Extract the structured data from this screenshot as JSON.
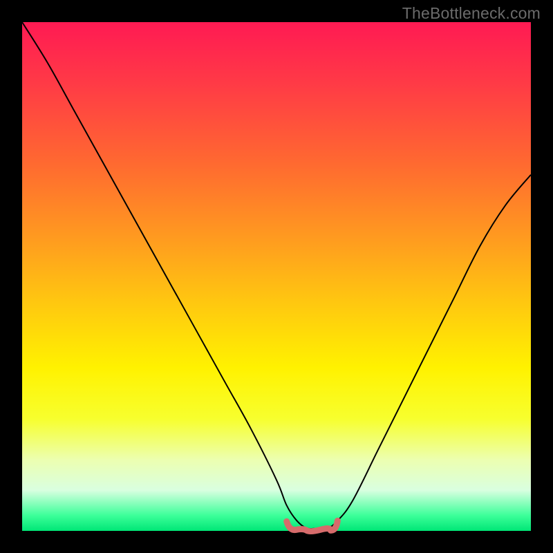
{
  "watermark": "TheBottleneck.com",
  "colors": {
    "frame": "#000000",
    "curve": "#000000",
    "trough_marker": "#d66b6b",
    "gradient_stops": [
      "#ff1a53",
      "#ff3a46",
      "#ff6a30",
      "#ff9920",
      "#ffc710",
      "#fff200",
      "#f7ff2e",
      "#ecffb0",
      "#d9ffe0",
      "#3bff99",
      "#00e676"
    ]
  },
  "chart_data": {
    "type": "line",
    "title": "",
    "xlabel": "",
    "ylabel": "",
    "annotations": [
      "TheBottleneck.com"
    ],
    "grid": false,
    "legend": false,
    "xlim": [
      0,
      100
    ],
    "ylim": [
      0,
      100
    ],
    "series": [
      {
        "name": "bottleneck-curve",
        "x": [
          0,
          5,
          10,
          15,
          20,
          25,
          30,
          35,
          40,
          45,
          50,
          52,
          54,
          56,
          58,
          60,
          62,
          65,
          70,
          75,
          80,
          85,
          90,
          95,
          100
        ],
        "values": [
          100,
          92,
          83,
          74,
          65,
          56,
          47,
          38,
          29,
          20,
          10,
          5,
          2,
          0.5,
          0.5,
          0.5,
          2,
          6,
          16,
          26,
          36,
          46,
          56,
          64,
          70
        ]
      }
    ],
    "trough_marker": {
      "x_start": 52,
      "x_end": 62,
      "y": 0.5
    }
  }
}
